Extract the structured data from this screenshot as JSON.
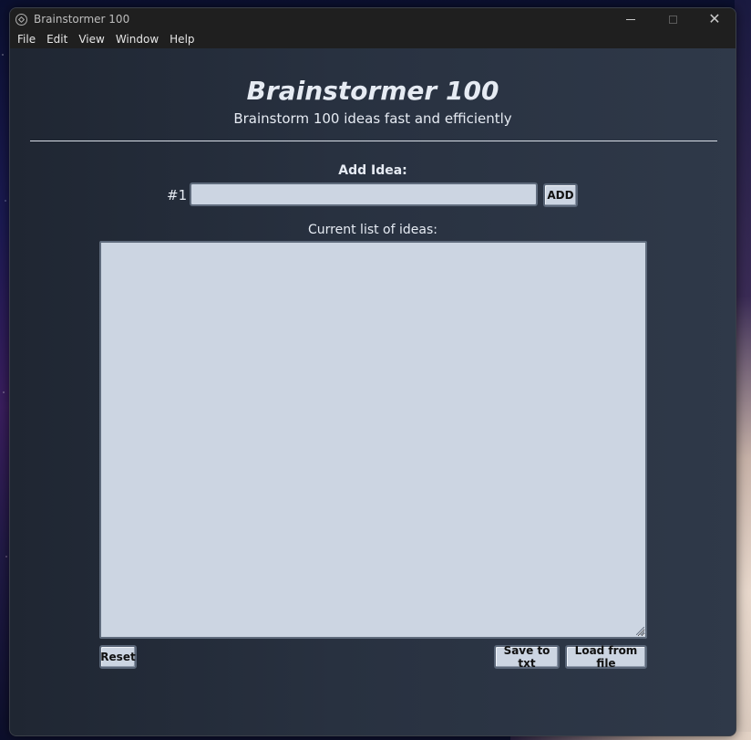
{
  "window": {
    "title": "Brainstormer 100",
    "controls": {
      "minimize_icon": "minimize-icon",
      "maximize_icon": "maximize-icon",
      "close_icon": "close-icon"
    }
  },
  "menu": [
    "File",
    "Edit",
    "View",
    "Window",
    "Help"
  ],
  "app": {
    "title": "Brainstormer 100",
    "subtitle": "Brainstorm 100 ideas fast and efficiently",
    "add_label": "Add Idea:",
    "idea_number": "#1",
    "idea_input_value": "",
    "add_button": "ADD",
    "list_label": "Current list of ideas:",
    "list_value": "",
    "reset_button": "Reset",
    "save_button": "Save to txt",
    "load_button": "Load from file"
  },
  "colors": {
    "background": "#283140",
    "field": "#ccd5e2",
    "text": "#e6ebf3"
  }
}
